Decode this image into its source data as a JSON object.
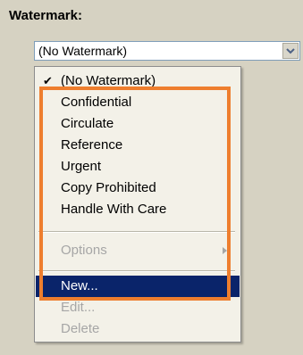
{
  "section": {
    "title": "Watermark:"
  },
  "combo": {
    "value": "(No Watermark)",
    "button_icon": "chevron-down-icon"
  },
  "menu": {
    "items": [
      {
        "label": "(No Watermark)",
        "checked": true,
        "enabled": true
      },
      {
        "label": "Confidential",
        "enabled": true
      },
      {
        "label": "Circulate",
        "enabled": true
      },
      {
        "label": "Reference",
        "enabled": true
      },
      {
        "label": "Urgent",
        "enabled": true
      },
      {
        "label": "Copy Prohibited",
        "enabled": true
      },
      {
        "label": "Handle With Care",
        "enabled": true
      },
      {
        "label": "Options",
        "enabled": false,
        "has_submenu": true
      },
      {
        "label": "New...",
        "enabled": true,
        "selected": true
      },
      {
        "label": "Edit...",
        "enabled": false
      },
      {
        "label": "Delete",
        "enabled": false
      }
    ]
  },
  "colors": {
    "panel_bg": "#d6d2c2",
    "menu_bg": "#f3f1e8",
    "selection": "#0a246a",
    "highlight_outline": "#ee7e2e"
  }
}
